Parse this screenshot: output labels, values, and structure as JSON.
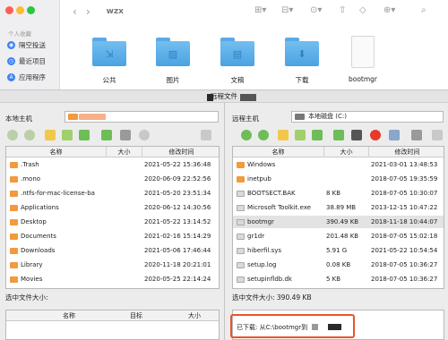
{
  "finder": {
    "window_title": "wzx",
    "sidebar_section": "个人收藏",
    "sidebar_items": [
      {
        "label": "隔空投送",
        "icon": "airdrop-icon"
      },
      {
        "label": "最近项目",
        "icon": "clock-icon"
      },
      {
        "label": "应用程序",
        "icon": "applications-icon"
      }
    ],
    "items": [
      {
        "label": "公共",
        "glyph": "⇲"
      },
      {
        "label": "图片",
        "glyph": "▨"
      },
      {
        "label": "文稿",
        "glyph": "▤"
      },
      {
        "label": "下载",
        "glyph": "⬇"
      },
      {
        "label": "bootmgr",
        "glyph": ""
      }
    ]
  },
  "transfer": {
    "title": "远程文件",
    "local": {
      "host_label": "本地主机",
      "columns": {
        "name": "名称",
        "size": "大小",
        "date": "修改时间"
      },
      "rows": [
        {
          "name": ".Trash",
          "size": "",
          "date": "2021-05-22 15:36:48"
        },
        {
          "name": ".mono",
          "size": "",
          "date": "2020-06-09 22:52:56"
        },
        {
          "name": ".ntfs-for-mac-license-ba",
          "size": "",
          "date": "2021-05-20 23:51:34"
        },
        {
          "name": "Applications",
          "size": "",
          "date": "2020-06-12 14:30:56"
        },
        {
          "name": "Desktop",
          "size": "",
          "date": "2021-05-22 13:14:52"
        },
        {
          "name": "Documents",
          "size": "",
          "date": "2021-02-16 15:14:29"
        },
        {
          "name": "Downloads",
          "size": "",
          "date": "2021-05-06 17:46:44"
        },
        {
          "name": "Library",
          "size": "",
          "date": "2020-11-18 20:21:01"
        },
        {
          "name": "Movies",
          "size": "",
          "date": "2020-05-25 22:14:24"
        }
      ],
      "size_label": "选中文件大小:",
      "queue_columns": {
        "name": "名称",
        "target": "目标",
        "size": "大小"
      }
    },
    "remote": {
      "host_label": "远程主机",
      "drive": "本地磁盘 (C:)",
      "columns": {
        "name": "名称",
        "size": "大小",
        "date": "修改时间"
      },
      "rows": [
        {
          "name": "Windows",
          "size": "",
          "date": "2021-03-01 13:48:53",
          "type": "folder"
        },
        {
          "name": "inetpub",
          "size": "",
          "date": "2018-07-05 19:35:59",
          "type": "folder"
        },
        {
          "name": "BOOTSECT.BAK",
          "size": "8 KB",
          "date": "2018-07-05 10:30:07",
          "type": "file"
        },
        {
          "name": "Microsoft Toolkit.exe",
          "size": "38.89 MB",
          "date": "2013-12-15 10:47:22",
          "type": "file"
        },
        {
          "name": "bootmgr",
          "size": "390.49 KB",
          "date": "2018-11-18 10:44:07",
          "type": "file"
        },
        {
          "name": "gr1dr",
          "size": "201.48 KB",
          "date": "2018-07-05 15:02:18",
          "type": "file"
        },
        {
          "name": "hiberfil.sys",
          "size": "5.91 G",
          "date": "2021-05-22 10:54:54",
          "type": "file"
        },
        {
          "name": "setup.log",
          "size": "0.08 KB",
          "date": "2018-07-05 10:36:27",
          "type": "file"
        },
        {
          "name": "setupinfldb.dk",
          "size": "5 KB",
          "date": "2018-07-05 10:36:27",
          "type": "file"
        }
      ],
      "size_label": "选中文件大小:  390.49 KB",
      "download_status": "已下载: 从C:\\bootmgr到"
    }
  },
  "colors": {
    "accent": "#e8542b",
    "folder": "#5aa9e6",
    "folder_icon": "#f29a3c",
    "selected_row": "#e3e3e3"
  }
}
